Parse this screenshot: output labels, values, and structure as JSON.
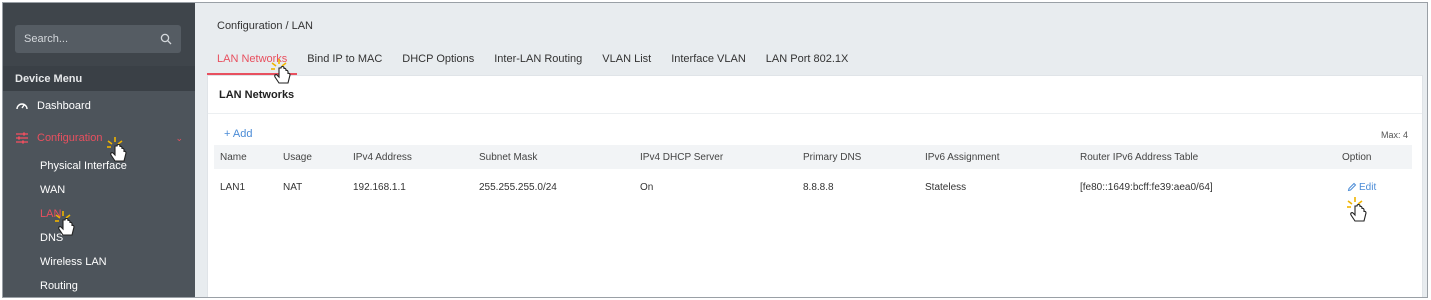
{
  "sidebar": {
    "search_placeholder": "Search...",
    "section_title": "Device Menu",
    "items": [
      {
        "label": "Dashboard",
        "icon": "speedometer-icon"
      },
      {
        "label": "Configuration",
        "icon": "sliders-icon",
        "expanded": true
      }
    ],
    "sub_items": [
      "Physical Interface",
      "WAN",
      "LAN",
      "DNS",
      "Wireless LAN",
      "Routing"
    ],
    "active_sub_item": "LAN"
  },
  "breadcrumb": "Configuration / LAN",
  "tabs": [
    {
      "label": "LAN Networks",
      "active": true
    },
    {
      "label": "Bind IP to MAC"
    },
    {
      "label": "DHCP Options"
    },
    {
      "label": "Inter-LAN Routing"
    },
    {
      "label": "VLAN List"
    },
    {
      "label": "Interface VLAN"
    },
    {
      "label": "LAN Port 802.1X"
    }
  ],
  "panel": {
    "title": "LAN Networks",
    "add_label": "+ Add",
    "max_label": "Max: 4",
    "columns": [
      "Name",
      "Usage",
      "IPv4 Address",
      "Subnet Mask",
      "IPv4 DHCP Server",
      "Primary DNS",
      "IPv6 Assignment",
      "Router IPv6 Address Table",
      "Option"
    ],
    "rows": [
      [
        "LAN1",
        "NAT",
        "192.168.1.1",
        "255.255.255.0/24",
        "On",
        "8.8.8.8",
        "Stateless",
        "[fe80::1649:bcff:fe39:aea0/64]",
        "Edit"
      ]
    ]
  },
  "colors": {
    "accent": "#e8505f",
    "link": "#4a8bd6",
    "sidebar_bg": "#4d545b"
  }
}
